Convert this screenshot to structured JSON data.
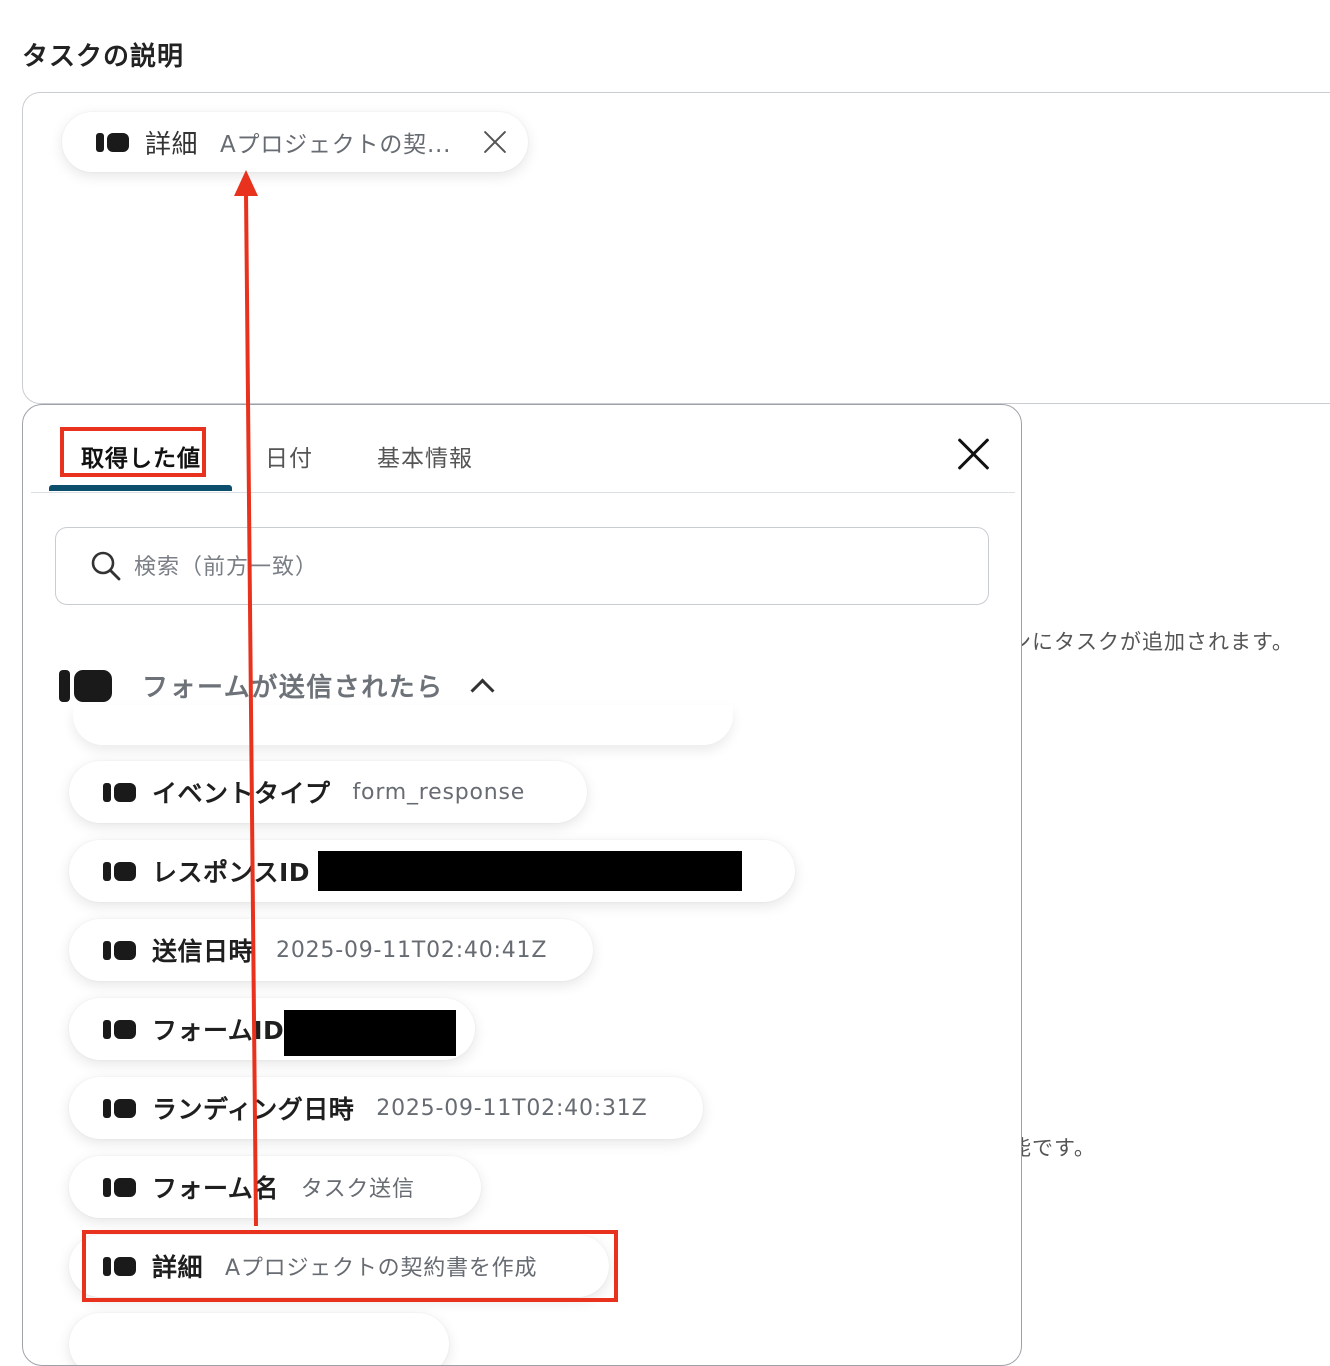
{
  "section": {
    "title": "タスクの説明"
  },
  "selected_pill": {
    "label": "詳細",
    "value": "Aプロジェクトの契..."
  },
  "background": {
    "hint_1": "ンにタスクが追加されます。",
    "hint_2": "能です。"
  },
  "panel": {
    "tabs": [
      {
        "label": "取得した値",
        "active": true
      },
      {
        "label": "日付",
        "active": false
      },
      {
        "label": "基本情報",
        "active": false
      }
    ],
    "search": {
      "placeholder": "検索（前方一致）",
      "value": ""
    },
    "group": {
      "label": "フォームが送信されたら",
      "expanded": true
    },
    "items": [
      {
        "label": "イベントタイプ",
        "value": "form_response",
        "redacted": false
      },
      {
        "label": "レスポンスID",
        "value": "",
        "redacted": true
      },
      {
        "label": "送信日時",
        "value": "2025-09-11T02:40:41Z",
        "redacted": false
      },
      {
        "label": "フォームID",
        "value": "",
        "redacted": true
      },
      {
        "label": "ランディング日時",
        "value": "2025-09-11T02:40:31Z",
        "redacted": false
      },
      {
        "label": "フォーム名",
        "value": "タスク送信",
        "redacted": false
      },
      {
        "label": "詳細",
        "value": "Aプロジェクトの契約書を作成",
        "redacted": false
      }
    ]
  },
  "colors": {
    "annotation_red": "#e8321d",
    "tab_underline": "#0b4f6c",
    "border": "#c9ccd1"
  },
  "icons": {
    "pill_icon": "variable-block-icon",
    "close": "close-icon",
    "search": "search-icon",
    "collapse": "chevron-up-icon"
  }
}
